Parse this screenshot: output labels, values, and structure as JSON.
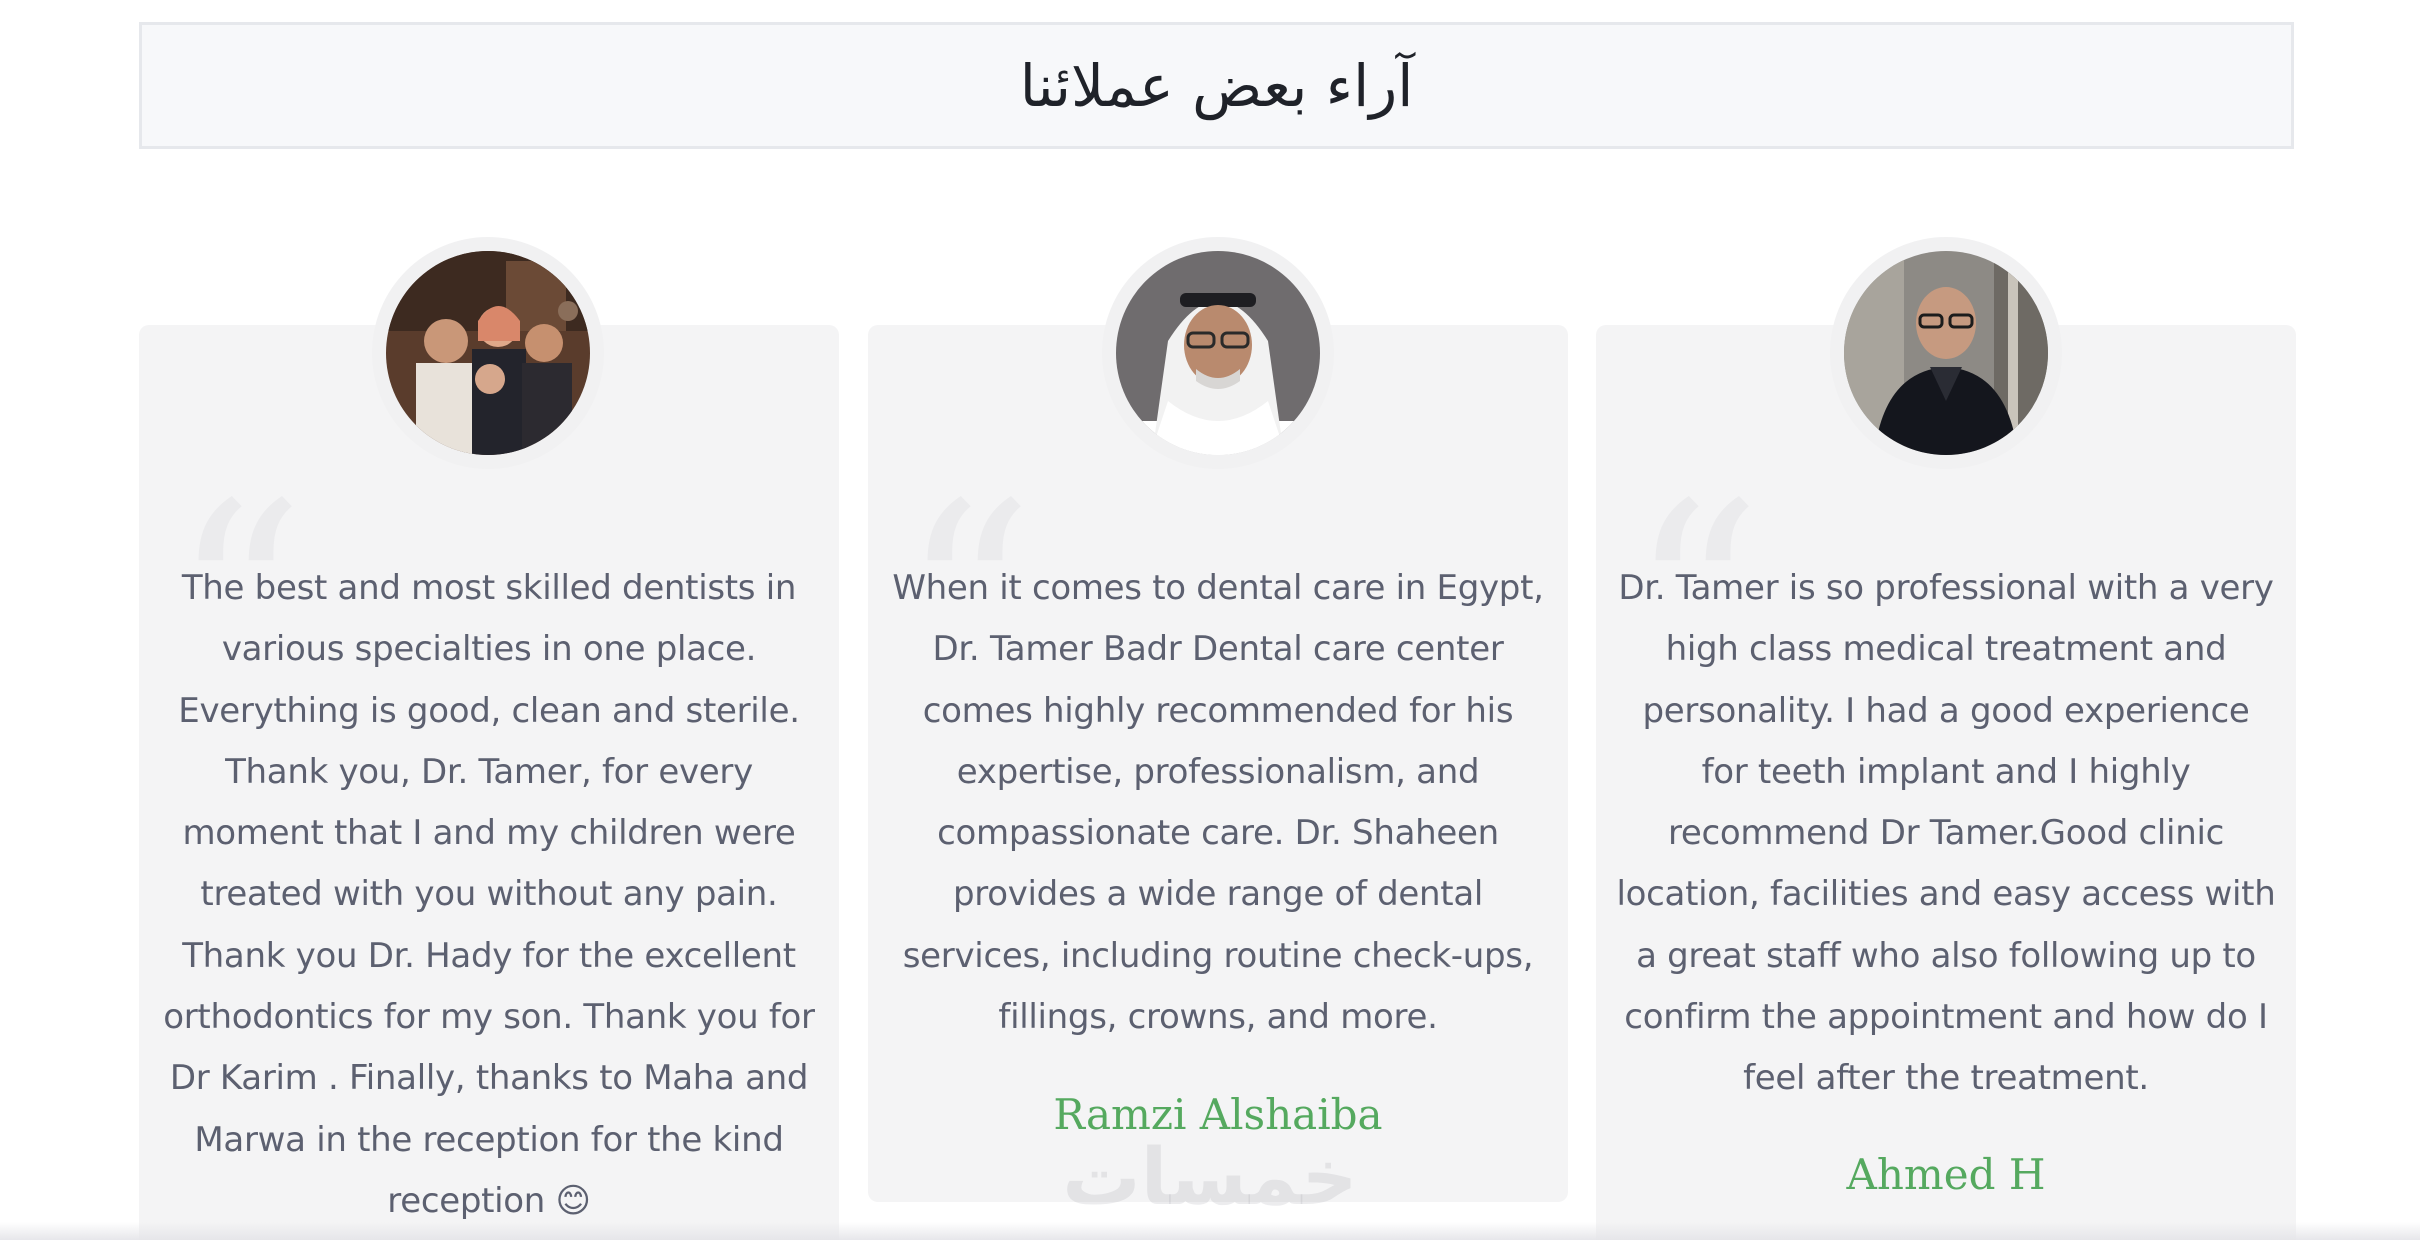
{
  "section": {
    "title": "آراء بعض عملائنا"
  },
  "testimonials": [
    {
      "avatar": "family-group-photo",
      "text": "The best and most skilled dentists in various specialties in one place. Everything is good, clean and sterile. Thank you, Dr. Tamer, for every moment that I and my children were treated with you without any pain. Thank you Dr. Hady for the excellent orthodontics for my son. Thank you for Dr Karim . Finally, thanks to Maha and Marwa in the reception for the kind reception 😊",
      "name": ""
    },
    {
      "avatar": "man-in-white-ghutra-photo",
      "text": "When it comes to dental care in Egypt, Dr. Tamer Badr Dental care center comes highly recommended for his expertise, professionalism, and compassionate care. Dr. Shaheen provides a wide range of dental services, including routine check-ups, fillings, crowns, and more.",
      "name": "Ramzi Alshaiba"
    },
    {
      "avatar": "man-with-glasses-photo",
      "text": "Dr. Tamer is so professional with a very high class medical treatment and personality. I had a good experience for teeth implant and I highly recommend Dr Tamer.Good clinic location, facilities and easy access with a great staff who also following up to confirm the appointment and how do I feel after the treatment.",
      "name": "Ahmed H"
    }
  ],
  "quote_icon": "quote-icon",
  "watermark": "خمسات"
}
